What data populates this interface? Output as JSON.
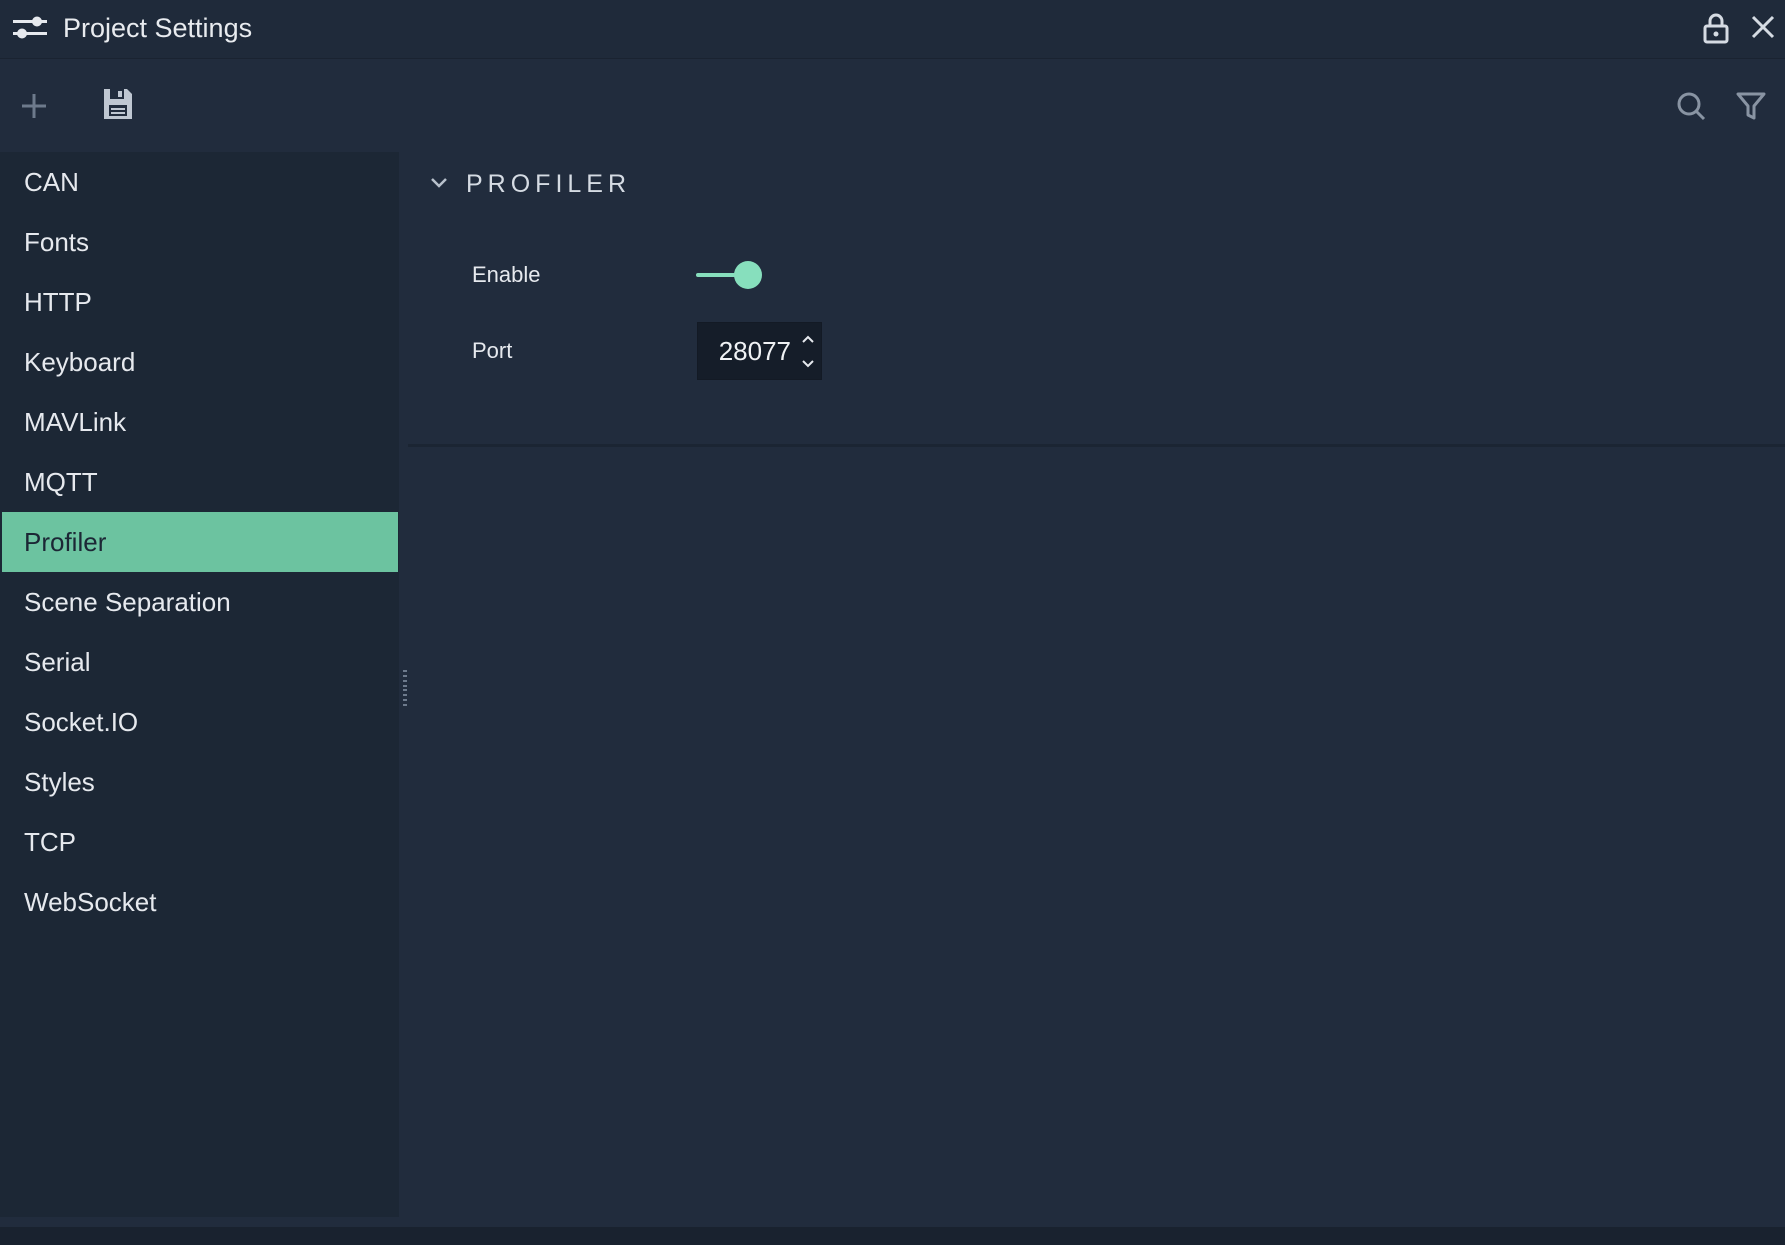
{
  "window": {
    "title": "Project Settings"
  },
  "icons": {
    "title": "settings-sliders-icon",
    "lock": "lock-icon",
    "close": "close-icon",
    "add": "plus-icon",
    "save": "floppy-disk-icon",
    "search": "search-icon",
    "filter": "filter-icon",
    "chevron": "chevron-down-icon"
  },
  "sidebar": {
    "selected_index": 6,
    "items": [
      {
        "label": "CAN"
      },
      {
        "label": "Fonts"
      },
      {
        "label": "HTTP"
      },
      {
        "label": "Keyboard"
      },
      {
        "label": "MAVLink"
      },
      {
        "label": "MQTT"
      },
      {
        "label": "Profiler"
      },
      {
        "label": "Scene Separation"
      },
      {
        "label": "Serial"
      },
      {
        "label": "Socket.IO"
      },
      {
        "label": "Styles"
      },
      {
        "label": "TCP"
      },
      {
        "label": "WebSocket"
      }
    ]
  },
  "section": {
    "title": "PROFILER",
    "expanded": true,
    "fields": {
      "enable": {
        "label": "Enable",
        "value": true
      },
      "port": {
        "label": "Port",
        "value": "28077"
      }
    }
  },
  "colors": {
    "accent": "#6cc3a0",
    "toggle_on": "#87dfbd",
    "background": "#212c3d",
    "sidebar": "#1c2735"
  }
}
